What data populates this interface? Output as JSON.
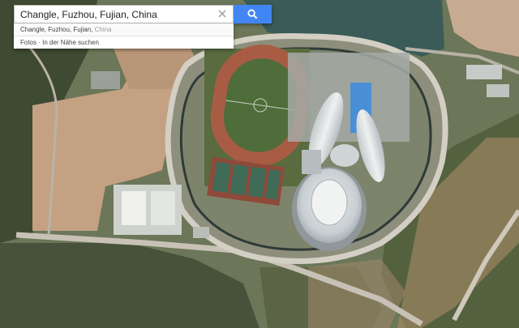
{
  "search": {
    "value": "Changle, Fuzhou, Fujian, China",
    "clear_icon": "close-icon",
    "button_icon": "search-icon",
    "button_color": "#4285f4"
  },
  "suggestions": [
    {
      "primary": "Changle, Fuzhou, Fujian,",
      "secondary": " China"
    },
    {
      "primary": "Fotos · In der Nähe suchen",
      "secondary": ""
    }
  ],
  "map": {
    "type": "satellite",
    "colors": {
      "track": "#a55a43",
      "field": "#4f6e3c",
      "forest": "#3f4d33",
      "dirt": "#c9a88a",
      "pool": "#4a8fd6"
    }
  }
}
